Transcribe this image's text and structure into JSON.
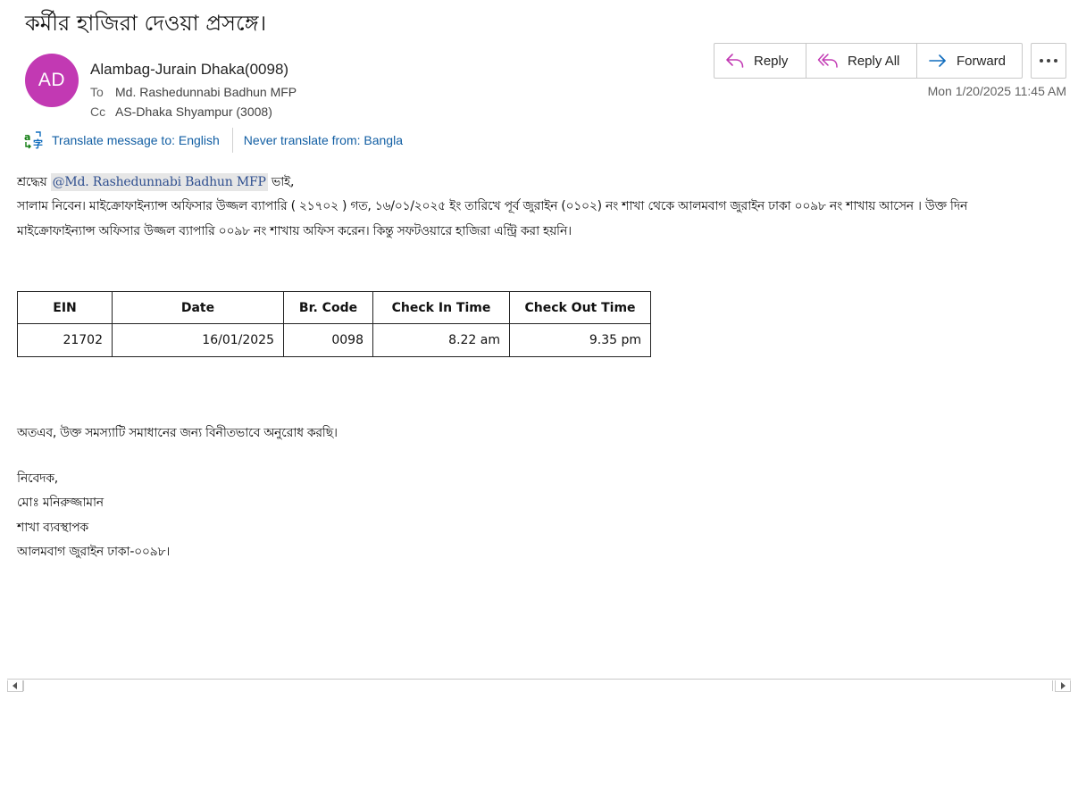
{
  "subject": "কর্মীর হাজিরা দেওয়া প্রসঙ্গে।",
  "avatar_initials": "AD",
  "avatar_color": "#c239b3",
  "sender": "Alambag-Jurain Dhaka(0098)",
  "recipients": {
    "to_label": "To",
    "to": "Md. Rashedunnabi Badhun MFP",
    "cc_label": "Cc",
    "cc": "AS-Dhaka Shyampur (3008)"
  },
  "actions": {
    "reply": "Reply",
    "reply_all": "Reply All",
    "forward": "Forward",
    "more_icon": "ellipsis-icon"
  },
  "timestamp": "Mon 1/20/2025 11:45 AM",
  "translate": {
    "icon": "translate-icon",
    "translate_link": "Translate message to: English",
    "never_link": "Never translate from: Bangla"
  },
  "body": {
    "greeting_prefix": "শ্রদ্ধেয়",
    "mention": "@Md. Rashedunnabi Badhun MFP",
    "greeting_suffix": "ভাই,",
    "line1": "সালাম নিবেন। মাইক্রোফাইন্যান্স অফিসার উজ্জল ব্যাপারি ( ২১৭০২ ) গত, ১৬/০১/২০২৫ ইং তারিখে পূর্ব জুরাইন (০১০২) নং শাখা থেকে আলমবাগ জুরাইন ঢাকা ০০৯৮ নং শাখায় আসেন । উক্ত দিন",
    "line2": "মাইক্রোফাইন্যান্স অফিসার উজ্জল ব্যাপারি ০০৯৮ নং শাখায় অফিস করেন। কিন্তু সফটওয়ারে হাজিরা এন্ট্রি করা হয়নি।",
    "request": "অতএব, উক্ত সমস্যাটি সমাধানের জন্য বিনীতভাবে অনুরোধ করছি।",
    "sign_1": "নিবেদক,",
    "sign_2": "মোঃ মনিরুজ্জামান",
    "sign_3": "শাখা ব্যবস্থাপক",
    "sign_4": "আলমবাগ জুরাইন ঢাকা-০০৯৮।"
  },
  "table": {
    "headers": [
      "EIN",
      "Date",
      "Br. Code",
      "Check In Time",
      "Check Out Time"
    ],
    "rows": [
      [
        "21702",
        "16/01/2025",
        "0098",
        "8.22 am",
        "9.35 pm"
      ]
    ]
  }
}
